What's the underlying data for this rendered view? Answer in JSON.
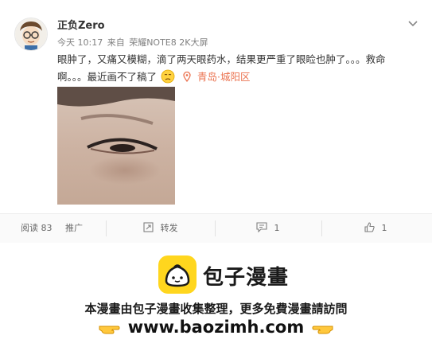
{
  "post": {
    "username": "正负Zero",
    "time": "今天 10:17",
    "source_prefix": "来自",
    "source": "荣耀NOTE8 2K大屏",
    "text_line1": "眼肿了，又痛又模糊，滴了两天眼药水，结果更严重了眼睑也肿了。。。救命",
    "text_line2": "啊。。。最近画不了稿了",
    "location": "青岛·城阳区"
  },
  "actions": {
    "read_label": "阅读 83",
    "promote_label": "推广",
    "share_label": "转发",
    "comment_count": "1",
    "like_count": "1"
  },
  "footer": {
    "brand": "包子漫畫",
    "notice": "本漫畫由包子漫畫收集整理，更多免費漫畫請訪問",
    "url": "www.baozimh.com"
  },
  "colors": {
    "location": "#eb7350",
    "brand_yellow": "#ffd61e"
  },
  "icons": [
    "chevron-down-icon",
    "location-pin-icon",
    "sad-emoji-icon",
    "share-icon",
    "comment-icon",
    "like-icon",
    "bun-logo-icon",
    "pointing-hand-icon"
  ]
}
